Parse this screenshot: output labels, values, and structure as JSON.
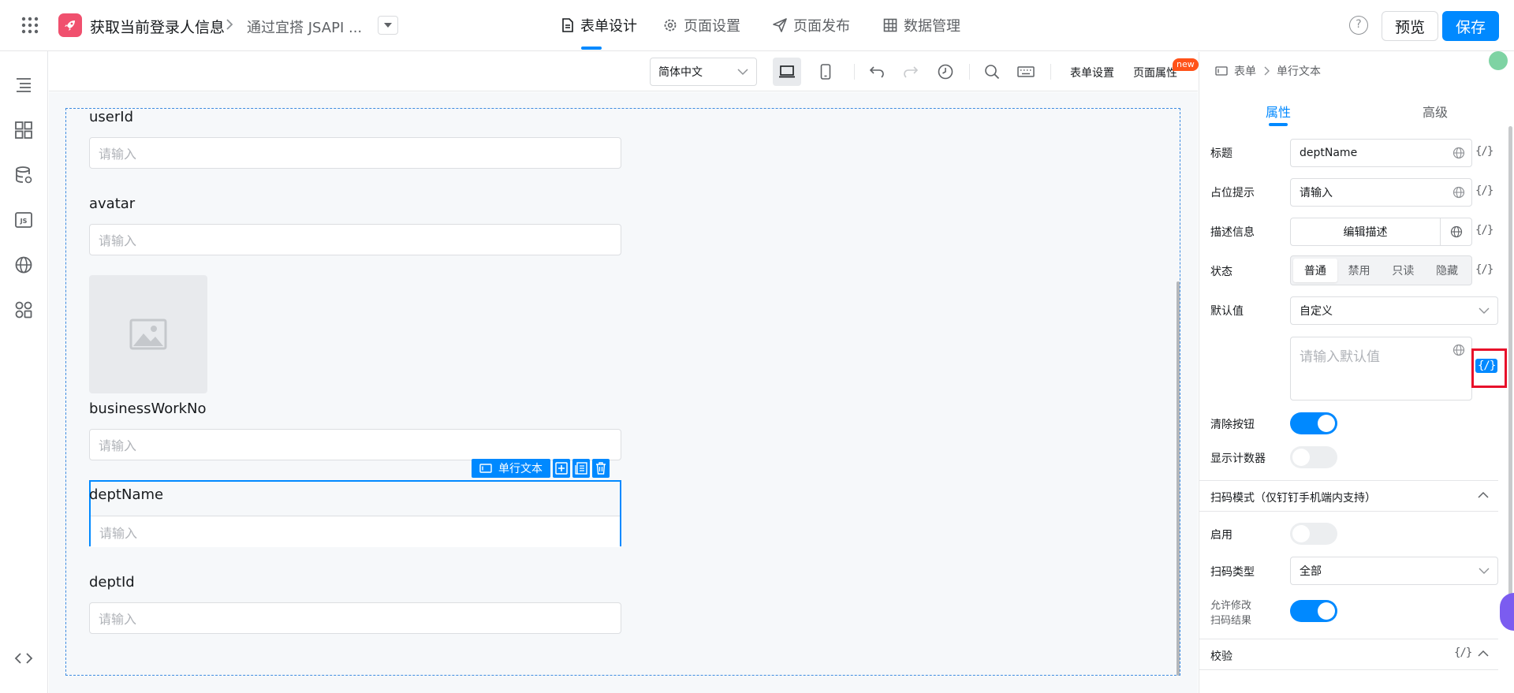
{
  "app": {
    "name": "获取当前登录人信息",
    "page": "通过宜搭 JSAPI ..."
  },
  "nav": {
    "tabs": [
      {
        "label": "表单设计",
        "icon": "document-icon"
      },
      {
        "label": "页面设置",
        "icon": "gear-icon"
      },
      {
        "label": "页面发布",
        "icon": "send-icon"
      },
      {
        "label": "数据管理",
        "icon": "table-icon"
      }
    ],
    "active_index": 0
  },
  "header": {
    "help_label": "?",
    "preview_label": "预览",
    "save_label": "保存"
  },
  "colors": {
    "accent": "#0089ff",
    "logo": "#f0506e",
    "highlight_frame": "#e8102a",
    "new_badge": "#ff5219"
  },
  "sidebar": {
    "items": [
      {
        "name": "outline-icon"
      },
      {
        "name": "components-icon"
      },
      {
        "name": "datasource-icon"
      },
      {
        "name": "js-icon"
      },
      {
        "name": "globe-icon"
      },
      {
        "name": "plugins-icon"
      },
      {
        "name": "code-icon"
      }
    ]
  },
  "toolbar": {
    "language": "简体中文",
    "form_settings": "表单设置",
    "page_props": "页面属性",
    "new_badge": "new"
  },
  "form": {
    "fields": [
      {
        "label": "userId",
        "placeholder": "请输入"
      },
      {
        "label": "avatar",
        "placeholder": "请输入"
      },
      {
        "label": "businessWorkNo",
        "placeholder": "请输入"
      },
      {
        "label": "deptName",
        "placeholder": "请输入"
      },
      {
        "label": "deptId",
        "placeholder": "请输入"
      }
    ],
    "selected_component": "单行文本"
  },
  "panel": {
    "breadcrumb": [
      "表单",
      "单行文本"
    ],
    "tabs": [
      "属性",
      "高级"
    ],
    "expr_label": "{/}",
    "props": {
      "title_label": "标题",
      "title_value": "deptName",
      "placeholder_label": "占位提示",
      "placeholder_value": "请输入",
      "desc_label": "描述信息",
      "desc_button": "编辑描述",
      "state_label": "状态",
      "state_options": [
        "普通",
        "禁用",
        "只读",
        "隐藏"
      ],
      "state_selected": "普通",
      "default_label": "默认值",
      "default_mode": "自定义",
      "default_placeholder": "请输入默认值",
      "clear_label": "清除按钮",
      "clear_on": true,
      "counter_label": "显示计数器",
      "counter_on": false
    },
    "scan": {
      "section_title": "扫码模式（仅钉钉手机端内支持）",
      "enable_label": "启用",
      "enable_on": false,
      "type_label": "扫码类型",
      "type_value": "全部",
      "allow_edit_label_1": "允许修改",
      "allow_edit_label_2": "扫码结果",
      "allow_edit_on": true
    },
    "validation": {
      "section_title": "校验"
    }
  }
}
